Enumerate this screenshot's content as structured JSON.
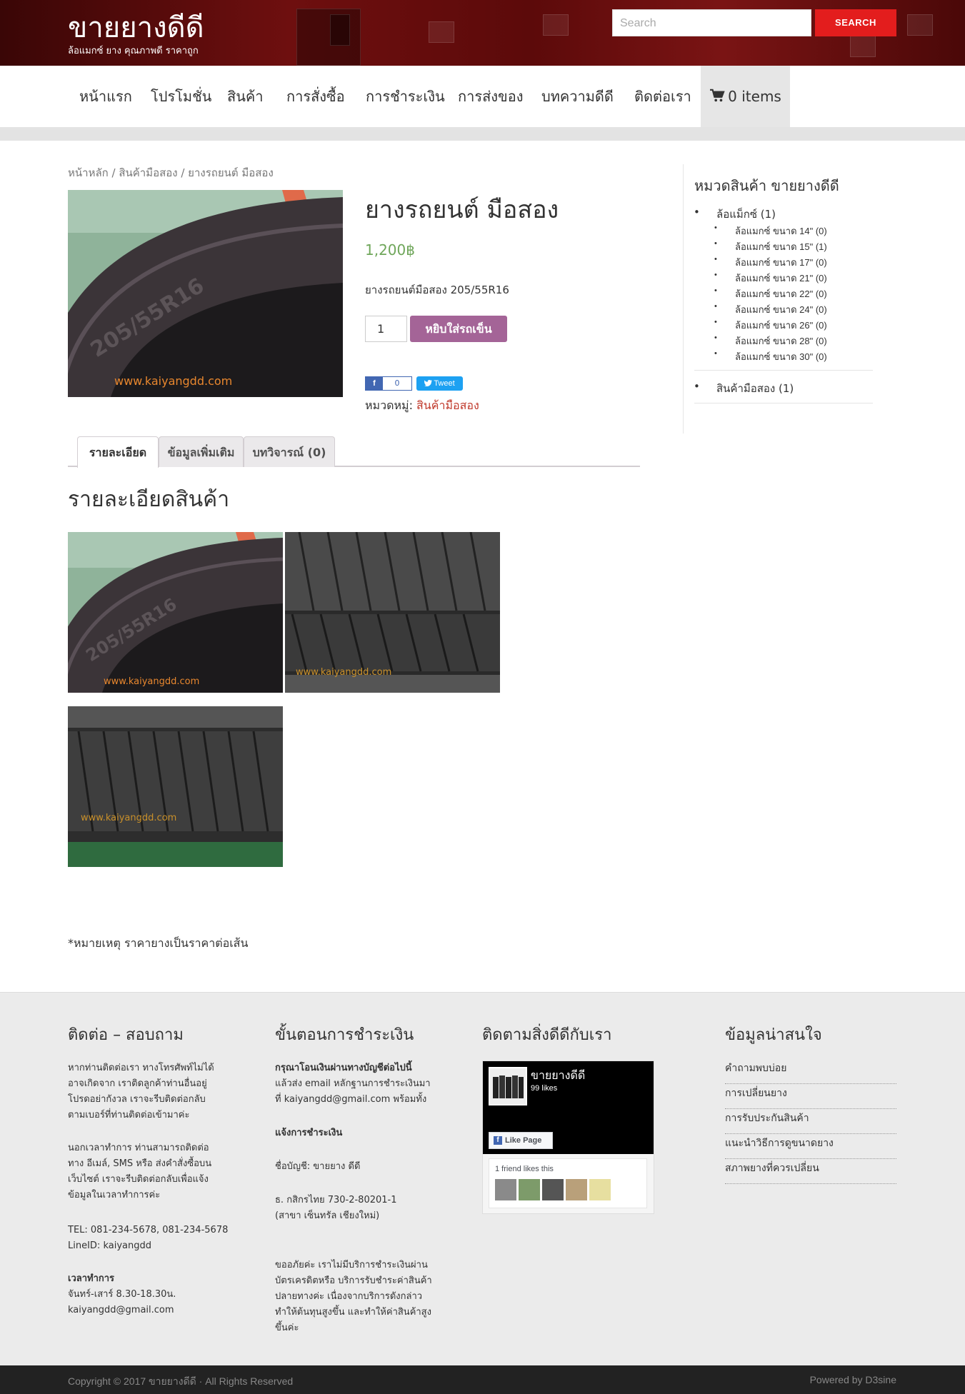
{
  "header": {
    "site_title": "ขายยางดีดี",
    "tagline": "ล้อแมกซ์ ยาง คุณภาพดี ราคาถูก",
    "search_placeholder": "Search",
    "search_button": "SEARCH"
  },
  "nav": {
    "items": [
      "หน้าแรก",
      "โปรโมชั่น",
      "สินค้า",
      "การสั่งซื้อ",
      "การชำระเงิน",
      "การส่งของ",
      "บทความดีดี",
      "ติดต่อเรา"
    ],
    "cart_label": "0 items"
  },
  "breadcrumb": "หน้าหลัก / สินค้ามือสอง / ยางรถยนต์ มือสอง",
  "product": {
    "title": "ยางรถยนต์ มือสอง",
    "price": "1,200฿",
    "short_desc": "ยางรถยนต์มือสอง 205/55R16",
    "qty": "1",
    "add_to_cart": "หยิบใส่รถเข็น",
    "fb_share_count": "0",
    "tweet_label": "Tweet",
    "category_label": "หมวดหมู่:",
    "category_value": "สินค้ามือสอง",
    "image_watermark": "www.kaiyangdd.com",
    "tire_size_marking": "205/55R16"
  },
  "tabs": [
    "รายละเอียด",
    "ข้อมูลเพิ่มเติม",
    "บทวิจารณ์ (0)"
  ],
  "description": {
    "title": "รายละเอียดสินค้า",
    "gallery_watermark": "www.kaiyangdd.com",
    "note": "*หมายเหตุ ราคายางเป็นราคาต่อเส้น"
  },
  "sidebar": {
    "title": "หมวดสินค้า ขายยางดีดี",
    "cat1": "ล้อแม็กซ์ (1)",
    "subs": [
      "ล้อแมกซ์ ขนาด 14\" (0)",
      "ล้อแมกซ์ ขนาด 15\" (1)",
      "ล้อแมกซ์ ขนาด 17\" (0)",
      "ล้อแมกซ์ ขนาด 21\" (0)",
      "ล้อแมกซ์ ขนาด 22\" (0)",
      "ล้อแมกซ์ ขนาด 24\" (0)",
      "ล้อแมกซ์ ขนาด 26\" (0)",
      "ล้อแมกซ์ ขนาด 28\" (0)",
      "ล้อแมกซ์ ขนาด 30\" (0)"
    ],
    "cat2": "สินค้ามือสอง (1)"
  },
  "footer": {
    "col1": {
      "title": "ติดต่อ – สอบถาม",
      "p1": [
        "หากท่านติดต่อเรา ทางโทรศัพท์ไม่ได้",
        "อาจเกิดจาก เราติดลูกค้าท่านอื่นอยู่",
        "โปรดอย่ากังวล เราจะรีบติดต่อกลับ",
        "ตามเบอร์ที่ท่านติดต่อเข้ามาค่ะ"
      ],
      "p2": [
        "นอกเวลาทำการ ท่านสามารถติดต่อ",
        "ทาง อีเมล์, SMS หรือ ส่งคำสั่งซื้อบน",
        "เว็บไซต์ เราจะรีบติดต่อกลับเพื่อแจ้ง",
        "ข้อมูลในเวลาทำการค่ะ"
      ],
      "tel": "TEL: 081-234-5678, 081-234-5678",
      "line": "LineID: kaiyangdd",
      "hours_title": "เวลาทำการ",
      "hours": "จันทร์-เสาร์ 8.30-18.30น.",
      "email": "kaiyangdd@gmail.com"
    },
    "col2": {
      "title": "ขั้นตอนการชำระเงิน",
      "p1_bold": "กรุณาโอนเงินผ่านทางบัญชีต่อไปนี้",
      "p1": [
        "แล้วส่ง email หลักฐานการชำระเงินมา",
        "ที่ kaiyangdd@gmail.com พร้อมทั้ง"
      ],
      "p2_bold": "แจ้งการชำระเงิน",
      "account": "ชื่อบัญชี: ขายยาง ดีดี",
      "bank": "ธ. กสิกรไทย 730-2-80201-1",
      "branch": "(สาขา เซ็นทรัล เชียงใหม่)",
      "p3": [
        "ขออภัยค่ะ เราไม่มีบริการชำระเงินผ่าน",
        "บัตรเครดิตหรือ บริการรับชำระค่าสินค้า",
        "ปลายทางค่ะ เนื่องจากบริการดังกล่าว",
        "ทำให้ต้นทุนสูงขึ้น และทำให้ค่าสินค้าสูง",
        "ขึ้นค่ะ"
      ]
    },
    "col3": {
      "title": "ติดตามสิ่งดีดีกับเรา",
      "fb_page_name": "ขายยางดีดี",
      "fb_likes": "99 likes",
      "fb_like_button": "Like Page",
      "fb_friends": "1 friend likes this"
    },
    "col4": {
      "title": "ข้อมูลน่าสนใจ",
      "links": [
        "คำถามพบบ่อย",
        "การเปลี่ยนยาง",
        "การรับประกันสินค้า",
        "แนะนำวิธีการดูขนาดยาง",
        "สภาพยางที่ควรเปลี่ยน"
      ]
    }
  },
  "bottom": {
    "copyright": "Copyright © 2017 ขายยางดีดี · All Rights Reserved",
    "powered": "Powered by D3sine"
  },
  "colors": {
    "accent_red": "#e31d1d",
    "price_green": "#6fa65a",
    "cart_button": "#a46497",
    "link_red": "#c0392b"
  }
}
